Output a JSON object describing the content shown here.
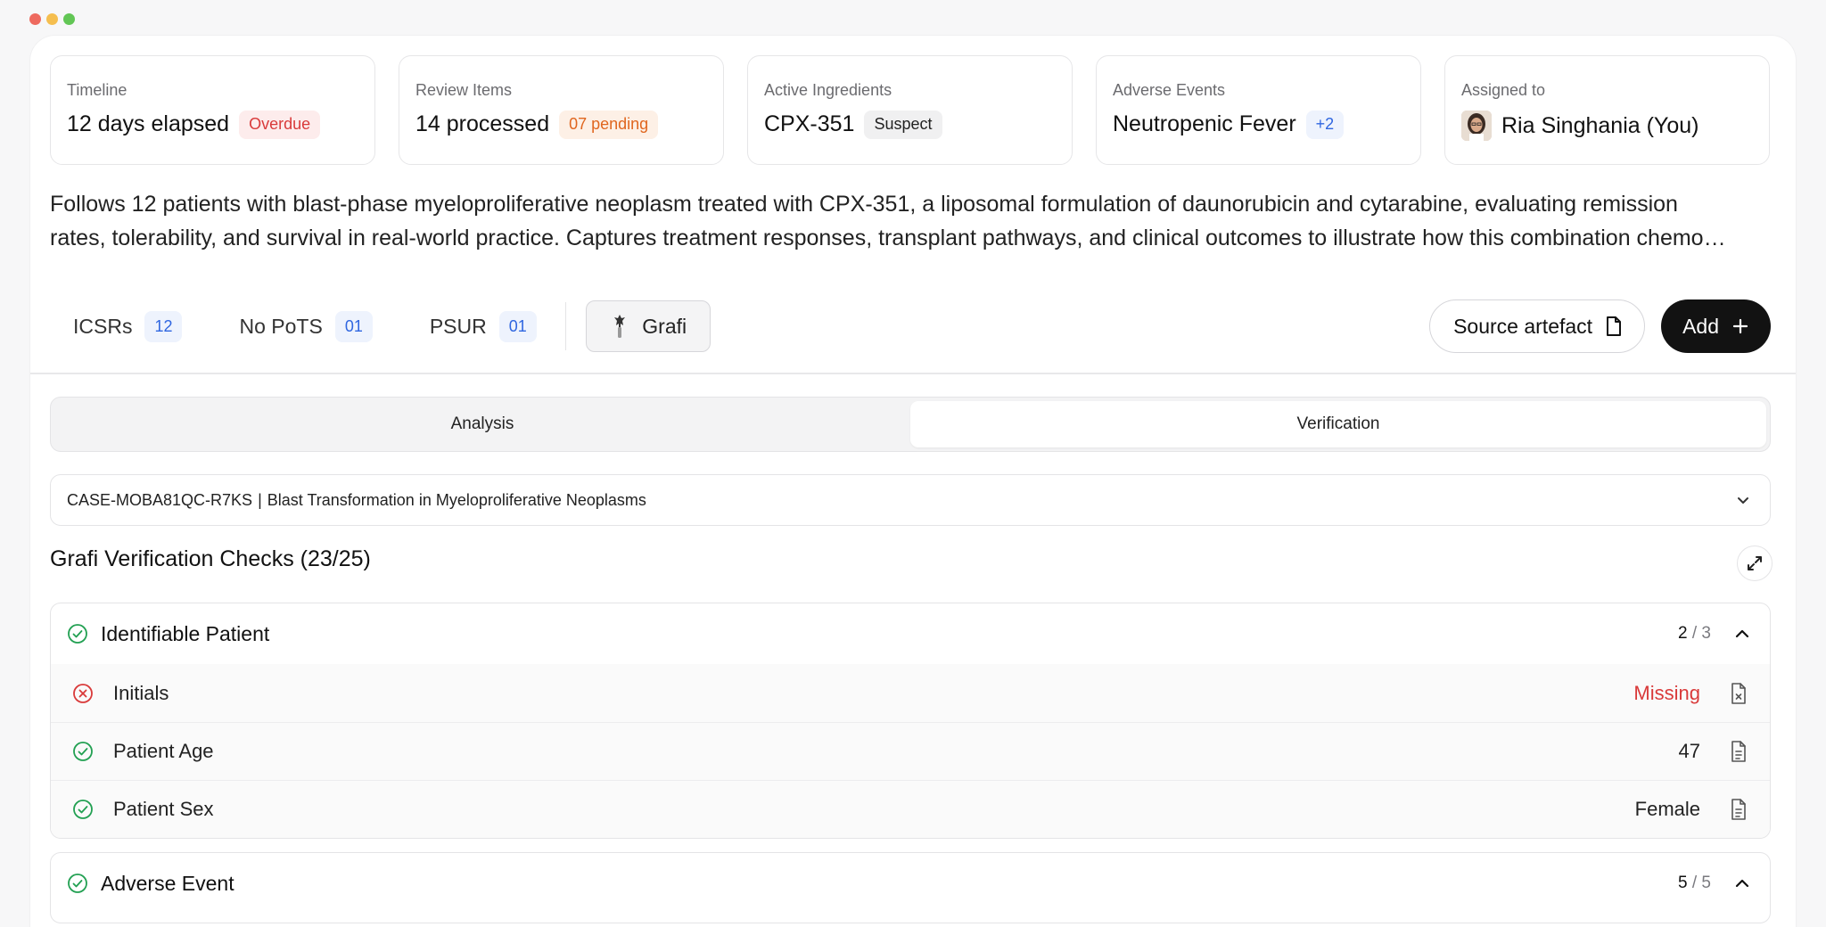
{
  "window": {
    "traffic_colors": [
      "#ee6a5f",
      "#f5be4f",
      "#62c655"
    ]
  },
  "summary_cards": [
    {
      "label": "Timeline",
      "value": "12 days elapsed",
      "badge": "Overdue"
    },
    {
      "label": "Review Items",
      "value": "14 processed",
      "badge": "07 pending"
    },
    {
      "label": "Active Ingredients",
      "value": "CPX-351",
      "badge": "Suspect"
    },
    {
      "label": "Adverse Events",
      "value": "Neutropenic Fever",
      "badge": "+2"
    },
    {
      "label": "Assigned to",
      "value": "Ria Singhania (You)"
    }
  ],
  "description": {
    "line1": "Follows 12 patients with blast-phase myeloproliferative neoplasm treated with CPX-351, a liposomal formulation of daunorubicin and cytarabine, evaluating remission",
    "line2": "rates, tolerability, and survival in real-world practice. Captures treatment responses, transplant pathways, and clinical outcomes to illustrate how this combination chemo…"
  },
  "toolbar": {
    "stats": [
      {
        "label": "ICSRs",
        "count": "12"
      },
      {
        "label": "No PoTS",
        "count": "01"
      },
      {
        "label": "PSUR",
        "count": "01"
      }
    ],
    "grafi_label": "Grafi",
    "source_label": "Source artefact",
    "add_label": "Add"
  },
  "tabs": [
    {
      "label": "Analysis"
    },
    {
      "label": "Verification",
      "active": true
    }
  ],
  "case_select": {
    "case_id": "CASE-MOBA81QC-R7KS",
    "separator": "|",
    "case_title": "Blast Transformation in Myeloproliferative Neoplasms"
  },
  "checks": {
    "title": "Grafi Verification Checks (23/25)",
    "groups": [
      {
        "title": "Identifiable Patient",
        "passed": "2",
        "total": "3",
        "items": [
          {
            "label": "Initials",
            "value": "Missing",
            "status": "fail"
          },
          {
            "label": "Patient Age",
            "value": "47",
            "status": "pass"
          },
          {
            "label": "Patient Sex",
            "value": "Female",
            "status": "pass"
          }
        ]
      },
      {
        "title": "Adverse Event",
        "passed": "5",
        "total": "5",
        "items": []
      }
    ]
  },
  "colors": {
    "success": "#22a052",
    "error": "#d93a3a",
    "accent_blue": "#2f66e0",
    "dark_button": "#121212"
  }
}
